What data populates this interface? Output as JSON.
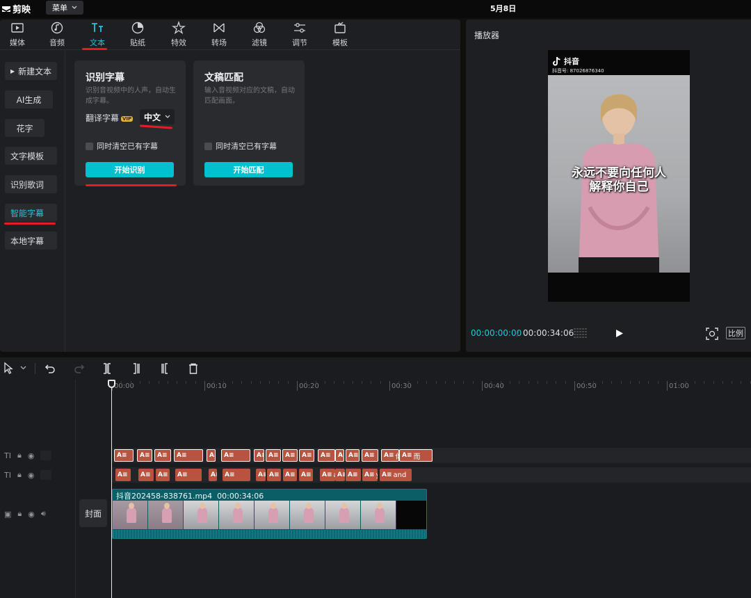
{
  "titlebar": {
    "app_name": "剪映",
    "menu_label": "菜单",
    "date": "5月8日"
  },
  "toolbar": {
    "tools": [
      {
        "label": "媒体",
        "icon": "media-icon"
      },
      {
        "label": "音频",
        "icon": "audio-icon"
      },
      {
        "label": "文本",
        "icon": "text-icon",
        "active": true
      },
      {
        "label": "贴纸",
        "icon": "sticker-icon"
      },
      {
        "label": "特效",
        "icon": "effects-icon"
      },
      {
        "label": "转场",
        "icon": "transition-icon"
      },
      {
        "label": "滤镜",
        "icon": "filter-icon"
      },
      {
        "label": "调节",
        "icon": "adjust-icon"
      },
      {
        "label": "模板",
        "icon": "template-icon"
      }
    ]
  },
  "sidebar": {
    "items": [
      {
        "label": "新建文本"
      },
      {
        "label": "AI生成"
      },
      {
        "label": "花字"
      },
      {
        "label": "文字模板"
      },
      {
        "label": "识别歌词"
      },
      {
        "label": "智能字幕",
        "active": true
      },
      {
        "label": "本地字幕"
      }
    ]
  },
  "cards": {
    "recognize": {
      "title": "识别字幕",
      "desc": "识别音视频中的人声，自动生成字幕。",
      "translate_label": "翻译字幕",
      "vip_badge": "VIP",
      "language": "中文",
      "clear_label": "同时清空已有字幕",
      "button": "开始识别"
    },
    "match": {
      "title": "文稿匹配",
      "desc": "输入音视频对应的文稿，自动匹配画面。",
      "clear_label": "同时清空已有字幕",
      "button": "开始匹配"
    }
  },
  "player": {
    "title": "播放器",
    "platform": "抖音",
    "account_id": "抖音号: 87026876340",
    "subtitle_line1": "永远不要向任何人",
    "subtitle_line2": "解释你自己",
    "time_current": "00:00:00:00",
    "time_total": "00:00:34:06",
    "ratio_label": "比例"
  },
  "timeline": {
    "ruler": [
      "00:00",
      "00:10",
      "00:20",
      "00:30",
      "00:40",
      "00:50",
      "01:00"
    ],
    "cover_label": "封面",
    "text_track_1": [
      "",
      "",
      "",
      "",
      "如",
      "",
      "在",
      "",
      "",
      "",
      "",
      "",
      "",
      "",
      "你",
      "而"
    ],
    "text_track_2": [
      "",
      "",
      "",
      "",
      "if y",
      "",
      "in t",
      "",
      "",
      "",
      "a",
      "",
      "",
      "yo",
      "and"
    ],
    "video_clip_name": "抖音202458-838761.mp4",
    "video_clip_duration": "00:00:34:06"
  },
  "colors": {
    "accent": "#21c6d9",
    "button": "#00c1cd",
    "text_clip": "#b9523f",
    "video_clip": "#0b5e66",
    "annotation": "#e51c23"
  }
}
